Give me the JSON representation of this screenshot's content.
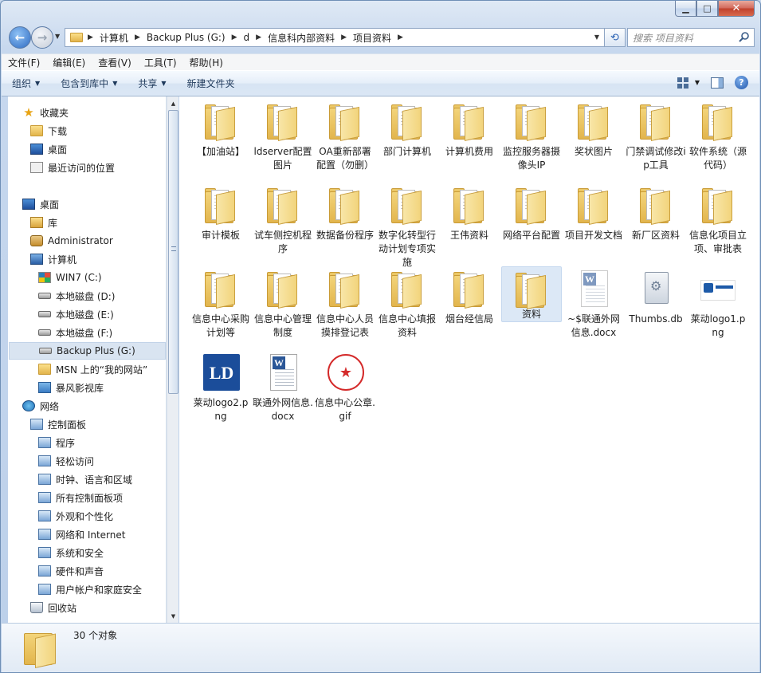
{
  "window": {
    "caption_min": "▁",
    "caption_max": "□",
    "caption_close": "✕"
  },
  "address": {
    "crumbs": [
      "计算机",
      "Backup Plus (G:)",
      "d",
      "信息科内部资料",
      "项目资料"
    ],
    "search_placeholder": "搜索 项目资料"
  },
  "menubar": [
    "文件(F)",
    "编辑(E)",
    "查看(V)",
    "工具(T)",
    "帮助(H)"
  ],
  "toolbar": {
    "organize": "组织",
    "include_library": "包含到库中",
    "share": "共享",
    "new_folder": "新建文件夹"
  },
  "navpane": {
    "items": [
      {
        "label": "收藏夹",
        "icon": "star-icon"
      },
      {
        "label": "下载",
        "icon": "folder-icon"
      },
      {
        "label": "桌面",
        "icon": "desktop-icon"
      },
      {
        "label": "最近访问的位置",
        "icon": "recent-places-icon"
      },
      {
        "label": "桌面",
        "icon": "desktop-icon"
      },
      {
        "label": "库",
        "icon": "library-icon"
      },
      {
        "label": "Administrator",
        "icon": "user-folder-icon"
      },
      {
        "label": "计算机",
        "icon": "computer-icon"
      },
      {
        "label": "WIN7 (C:)",
        "icon": "windows-drive-icon"
      },
      {
        "label": "本地磁盘 (D:)",
        "icon": "drive-icon"
      },
      {
        "label": "本地磁盘 (E:)",
        "icon": "drive-icon"
      },
      {
        "label": "本地磁盘 (F:)",
        "icon": "drive-icon"
      },
      {
        "label": "Backup Plus (G:)",
        "icon": "drive-icon"
      },
      {
        "label": "MSN 上的“我的网站”",
        "icon": "folder-icon"
      },
      {
        "label": "暴风影视库",
        "icon": "video-library-icon"
      },
      {
        "label": "网络",
        "icon": "network-icon"
      },
      {
        "label": "控制面板",
        "icon": "control-panel-icon"
      },
      {
        "label": "程序",
        "icon": "programs-icon"
      },
      {
        "label": "轻松访问",
        "icon": "ease-of-access-icon"
      },
      {
        "label": "时钟、语言和区域",
        "icon": "clock-language-icon"
      },
      {
        "label": "所有控制面板项",
        "icon": "all-control-panel-icon"
      },
      {
        "label": "外观和个性化",
        "icon": "appearance-icon"
      },
      {
        "label": "网络和 Internet",
        "icon": "network-internet-icon"
      },
      {
        "label": "系统和安全",
        "icon": "system-security-icon"
      },
      {
        "label": "硬件和声音",
        "icon": "hardware-sound-icon"
      },
      {
        "label": "用户帐户和家庭安全",
        "icon": "user-accounts-icon"
      },
      {
        "label": "回收站",
        "icon": "recycle-bin-icon"
      }
    ],
    "selected_index": 12
  },
  "files": [
    {
      "name": "【加油站】",
      "type": "folder"
    },
    {
      "name": "ldserver配置图片",
      "type": "folder"
    },
    {
      "name": "OA重新部署配置（勿删）",
      "type": "folder"
    },
    {
      "name": "部门计算机",
      "type": "folder"
    },
    {
      "name": "计算机费用",
      "type": "folder"
    },
    {
      "name": "监控服务器摄像头IP",
      "type": "folder"
    },
    {
      "name": "奖状图片",
      "type": "folder"
    },
    {
      "name": "门禁调试修改ip工具",
      "type": "folder"
    },
    {
      "name": "软件系统（源代码）",
      "type": "folder"
    },
    {
      "name": "审计模板",
      "type": "folder"
    },
    {
      "name": "试车侧控机程序",
      "type": "folder"
    },
    {
      "name": "数据备份程序",
      "type": "folder"
    },
    {
      "name": "数字化转型行动计划专项实施",
      "type": "folder"
    },
    {
      "name": "王伟资料",
      "type": "folder"
    },
    {
      "name": "网络平台配置",
      "type": "folder"
    },
    {
      "name": "项目开发文档",
      "type": "folder"
    },
    {
      "name": "新厂区资料",
      "type": "folder"
    },
    {
      "name": "信息化项目立项、审批表",
      "type": "folder"
    },
    {
      "name": "信息中心采购计划等",
      "type": "folder"
    },
    {
      "name": "信息中心管理制度",
      "type": "folder"
    },
    {
      "name": "信息中心人员摸排登记表",
      "type": "folder"
    },
    {
      "name": "信息中心填报资料",
      "type": "folder"
    },
    {
      "name": "烟台经信局",
      "type": "folder"
    },
    {
      "name": "资料",
      "type": "folder",
      "selected": true
    },
    {
      "name": "~$联通外网信息.docx",
      "type": "word-temp"
    },
    {
      "name": "Thumbs.db",
      "type": "db"
    },
    {
      "name": "莱动logo1.png",
      "type": "png1"
    },
    {
      "name": "莱动logo2.png",
      "type": "png2"
    },
    {
      "name": "联通外网信息.docx",
      "type": "word"
    },
    {
      "name": "信息中心公章.gif",
      "type": "gif"
    }
  ],
  "status": {
    "count_text": "30 个对象"
  }
}
